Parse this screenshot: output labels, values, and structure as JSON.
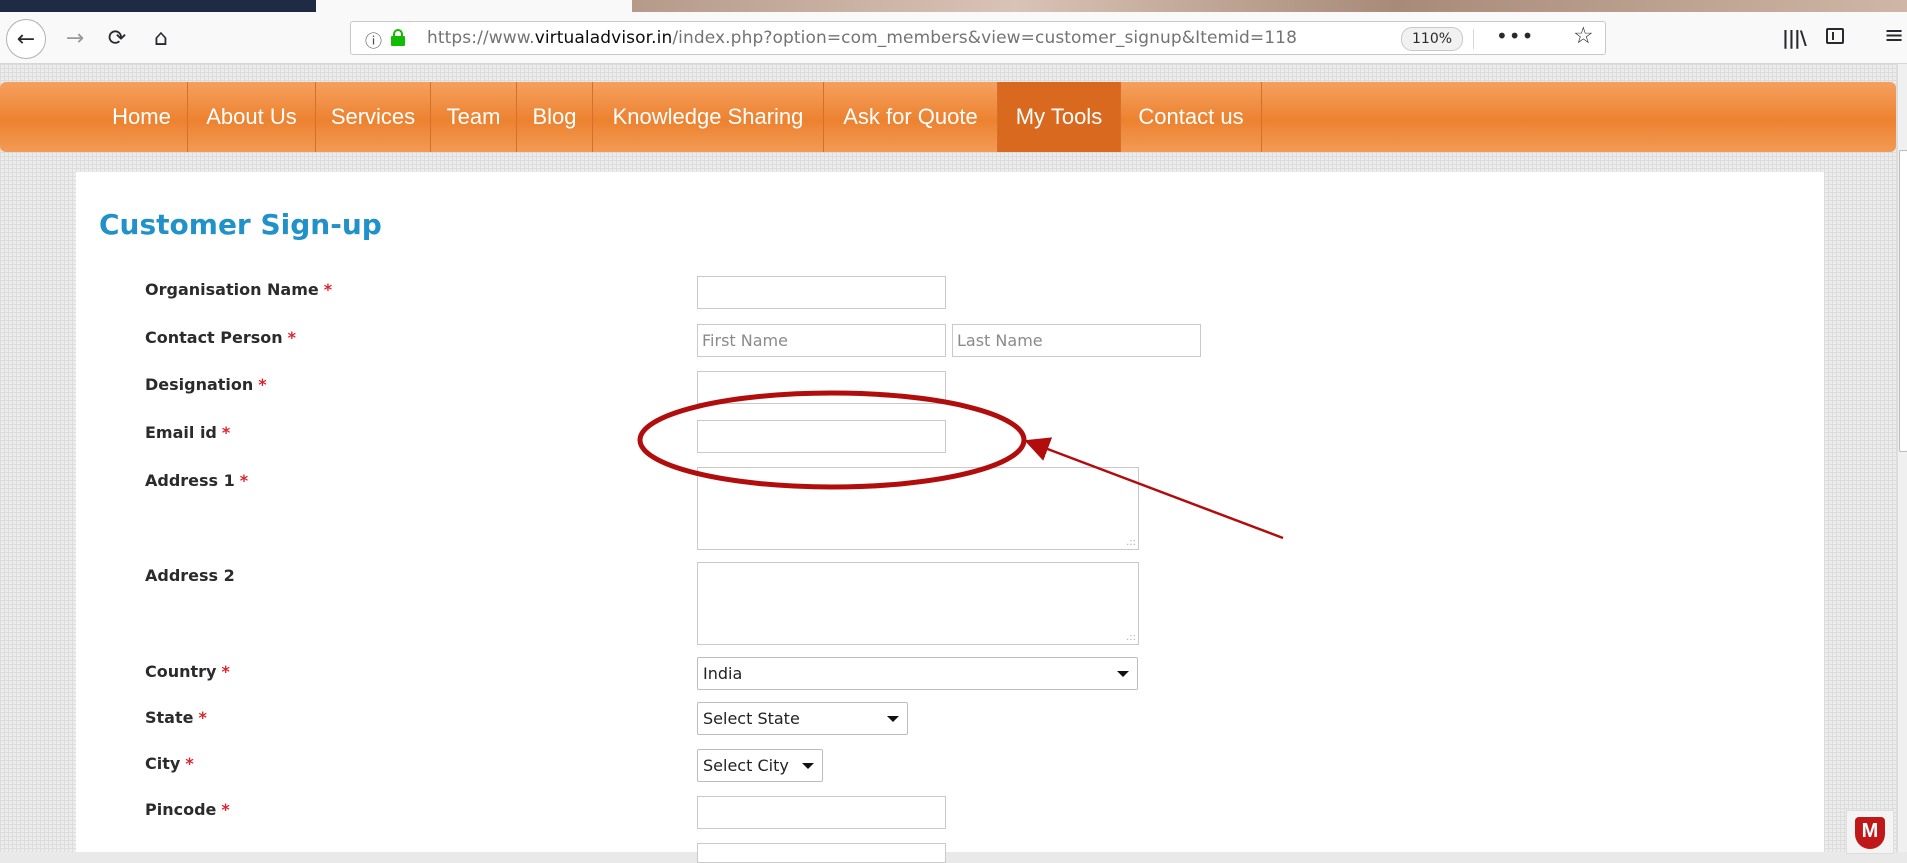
{
  "browser": {
    "url_prefix": "https://www.",
    "url_domain": "virtualadvisor.in",
    "url_path": "/index.php?option=com_members&view=customer_signup&Itemid=118",
    "zoom": "110%",
    "icons": {
      "back": "arrow-left-icon",
      "forward": "arrow-right-icon",
      "reload": "reload-icon",
      "home": "home-icon",
      "info": "info-icon",
      "lock": "lock-icon",
      "more": "ellipsis-icon",
      "pocket": "pocket-icon",
      "bookmark": "star-icon",
      "library": "library-icon",
      "sidebar": "sidebar-icon",
      "menu": "hamburger-menu-icon"
    },
    "glyphs": {
      "back": "←",
      "forward": "→",
      "reload": "⟳",
      "home": "⌂",
      "info": "ⓘ",
      "more": "•••",
      "star": "☆",
      "library": "|||\\",
      "menu": "≡"
    }
  },
  "nav": {
    "items": [
      {
        "label": "Home",
        "active": false
      },
      {
        "label": "About Us",
        "active": false
      },
      {
        "label": "Services",
        "active": false
      },
      {
        "label": "Team",
        "active": false
      },
      {
        "label": "Blog",
        "active": false
      },
      {
        "label": "Knowledge Sharing",
        "active": false
      },
      {
        "label": "Ask for Quote",
        "active": false
      },
      {
        "label": "My Tools",
        "active": true
      },
      {
        "label": "Contact us",
        "active": false
      }
    ],
    "color": "#ec8230",
    "active_color": "#d9691f"
  },
  "form": {
    "title": "Customer Sign-up",
    "required_marker": "*",
    "organisation_label": "Organisation Name",
    "contact_label": "Contact Person",
    "first_name_placeholder": "First Name",
    "last_name_placeholder": "Last Name",
    "designation_label": "Designation",
    "email_label": "Email id",
    "address1_label": "Address 1",
    "address2_label": "Address 2",
    "country_label": "Country",
    "country_value": "India",
    "state_label": "State",
    "state_value": "Select State",
    "city_label": "City",
    "city_value": "Select City",
    "pincode_label": "Pincode",
    "resize_grip": ".::"
  },
  "annotation": {
    "color": "#b20d0d",
    "highlighted_field": "Email id"
  },
  "badge": {
    "name": "mcafee-icon",
    "text": "M"
  },
  "colors": {
    "title": "#2191c9",
    "required": "#e0222c"
  }
}
